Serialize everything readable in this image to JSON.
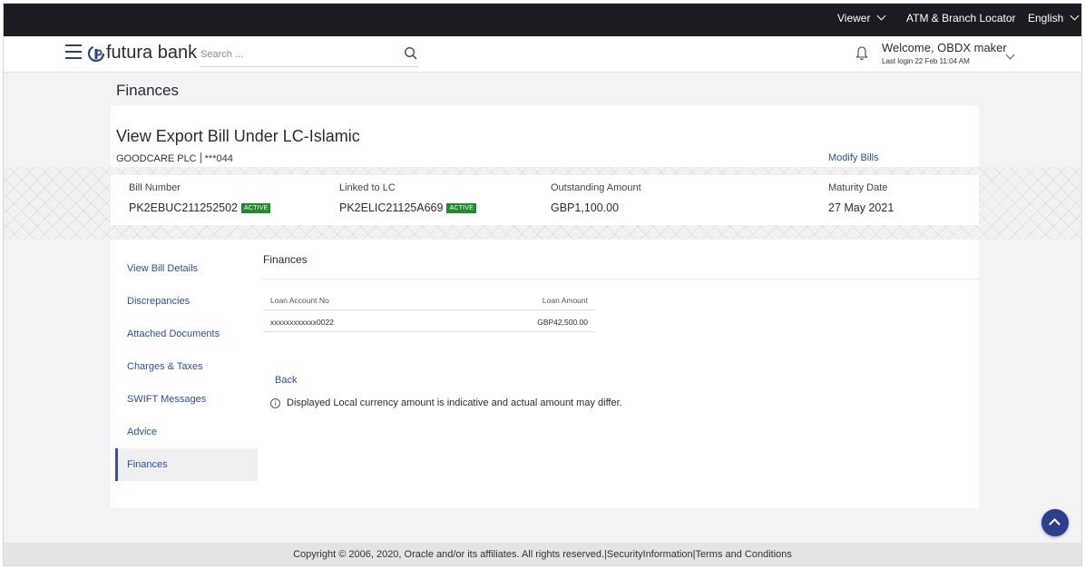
{
  "topbar": {
    "viewer_label": "Viewer",
    "atm_label": "ATM & Branch Locator",
    "language_label": "English"
  },
  "header": {
    "brand": "futura bank",
    "search_placeholder": "Search ...",
    "welcome": "Welcome, OBDX maker",
    "last_login": "Last login 22 Feb 11:04 AM"
  },
  "page": {
    "title": "Finances"
  },
  "bill": {
    "title": "View Export Bill Under LC-Islamic",
    "party_name": "GOODCARE PLC",
    "party_id": "***044",
    "modify_label": "Modify Bills",
    "summary": [
      {
        "label": "Bill Number",
        "value": "PK2EBUC211252502",
        "badge": "ACTIVE"
      },
      {
        "label": "Linked to LC",
        "value": "PK2ELIC21125A669",
        "badge": "ACTIVE"
      },
      {
        "label": "Outstanding Amount",
        "value": "GBP1,100.00"
      },
      {
        "label": "Maturity Date",
        "value": "27 May 2021"
      }
    ]
  },
  "sidenav": {
    "items": [
      {
        "label": "View Bill Details"
      },
      {
        "label": "Discrepancies"
      },
      {
        "label": "Attached Documents"
      },
      {
        "label": "Charges & Taxes"
      },
      {
        "label": "SWIFT Messages"
      },
      {
        "label": "Advice"
      },
      {
        "label": "Finances",
        "active": true
      }
    ]
  },
  "finances": {
    "section_title": "Finances",
    "columns": [
      "Loan Account No",
      "Loan Amount"
    ],
    "rows": [
      {
        "account": "xxxxxxxxxxxx0022",
        "amount": "GBP42,500.00"
      }
    ],
    "back_label": "Back",
    "note": "Displayed Local currency amount is indicative and actual amount may differ."
  },
  "footer": {
    "text": "Copyright © 2006, 2020, Oracle and/or its affiliates. All rights reserved.|SecurityInformation|Terms and Conditions"
  },
  "colors": {
    "topbar": "#1b1b22",
    "brand_blue": "#2c3e8c",
    "link": "#2c4ea8",
    "active_badge": "#1f8b2b"
  }
}
